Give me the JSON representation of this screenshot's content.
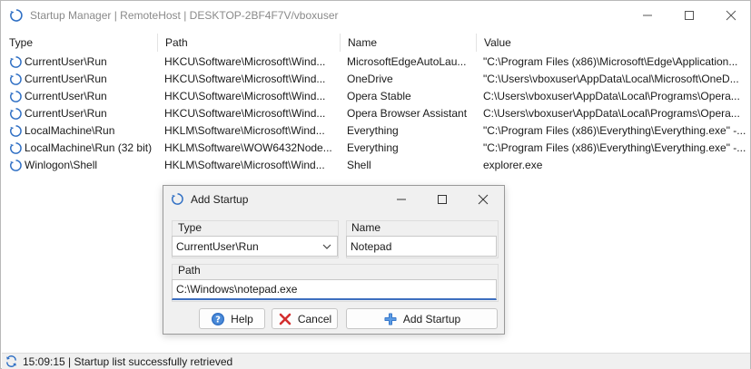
{
  "window": {
    "title": "Startup Manager | RemoteHost | DESKTOP-2BF4F7V/vboxuser"
  },
  "columns": [
    "Type",
    "Path",
    "Name",
    "Value"
  ],
  "rows": [
    {
      "type": "CurrentUser\\Run",
      "path": "HKCU\\Software\\Microsoft\\Wind...",
      "name": "MicrosoftEdgeAutoLau...",
      "value": "\"C:\\Program Files (x86)\\Microsoft\\Edge\\Application..."
    },
    {
      "type": "CurrentUser\\Run",
      "path": "HKCU\\Software\\Microsoft\\Wind...",
      "name": "OneDrive",
      "value": "\"C:\\Users\\vboxuser\\AppData\\Local\\Microsoft\\OneD..."
    },
    {
      "type": "CurrentUser\\Run",
      "path": "HKCU\\Software\\Microsoft\\Wind...",
      "name": "Opera Stable",
      "value": "C:\\Users\\vboxuser\\AppData\\Local\\Programs\\Opera..."
    },
    {
      "type": "CurrentUser\\Run",
      "path": "HKCU\\Software\\Microsoft\\Wind...",
      "name": "Opera Browser Assistant",
      "value": "C:\\Users\\vboxuser\\AppData\\Local\\Programs\\Opera..."
    },
    {
      "type": "LocalMachine\\Run",
      "path": "HKLM\\Software\\Microsoft\\Wind...",
      "name": "Everything",
      "value": "\"C:\\Program Files (x86)\\Everything\\Everything.exe\" -..."
    },
    {
      "type": "LocalMachine\\Run (32 bit)",
      "path": "HKLM\\Software\\WOW6432Node...",
      "name": "Everything",
      "value": "\"C:\\Program Files (x86)\\Everything\\Everything.exe\" -..."
    },
    {
      "type": "Winlogon\\Shell",
      "path": "HKLM\\Software\\Microsoft\\Wind...",
      "name": "Shell",
      "value": "explorer.exe"
    }
  ],
  "status": {
    "text": "15:09:15 | Startup list successfully retrieved"
  },
  "dialog": {
    "title": "Add Startup",
    "type_label": "Type",
    "type_value": "CurrentUser\\Run",
    "name_label": "Name",
    "name_value": "Notepad",
    "path_label": "Path",
    "path_value": "C:\\Windows\\notepad.exe",
    "help_label": "Help",
    "cancel_label": "Cancel",
    "add_label": "Add Startup"
  },
  "colors": {
    "accent": "#3c6ebf",
    "icon_blue": "#2f6fc4",
    "cancel_red": "#d32f2f"
  },
  "icons": {
    "app": "refresh-circle-icon",
    "row": "refresh-circle-icon",
    "help": "help-icon",
    "cancel": "cancel-x-icon",
    "add": "plus-icon",
    "status": "refresh-icon"
  }
}
